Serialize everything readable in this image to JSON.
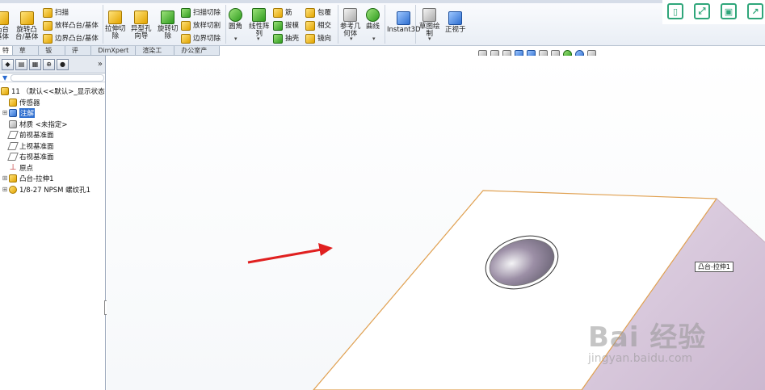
{
  "ribbon": {
    "col1": [
      "凸台",
      "基体"
    ],
    "col2": [
      "旋转凸",
      "台/基体"
    ],
    "sweep": "扫描",
    "loft_boss": "放样凸台/基体",
    "boundary_boss": "边界凸台/基体",
    "extrude_cut": [
      "拉伸切",
      "除"
    ],
    "hole_wizard": [
      "异型孔",
      "向导"
    ],
    "revolve_cut": [
      "旋转切",
      "除"
    ],
    "sweep_cut": "扫描切除",
    "loft_cut": "放样切割",
    "boundary_cut": "边界切除",
    "fillet": "圆角",
    "linear_pattern": [
      "线性阵",
      "列"
    ],
    "rib": "筋",
    "draft": "拔模",
    "shell": "抽壳",
    "wrap": "包覆",
    "intersect": "相交",
    "mirror": "镜向",
    "ref_geometry": [
      "参考几",
      "何体"
    ],
    "curves": "曲线",
    "instant3d": "Instant3D",
    "sketch": [
      "草图绘",
      "制"
    ],
    "normal_to": "正视于"
  },
  "tabs": [
    "特征",
    "草图",
    "钣金",
    "评估",
    "DimXpert",
    "渲染工具",
    "办公室产品"
  ],
  "tree": {
    "root": "11 （默认<<默认>_显示状态 1>）",
    "items": [
      {
        "label": "传感器",
        "icon": "sensor-icon"
      },
      {
        "label": "注解",
        "icon": "annotation-icon",
        "selected": true
      },
      {
        "label": "材质 <未指定>",
        "icon": "material-icon"
      },
      {
        "label": "前视基准面",
        "icon": "plane-icon"
      },
      {
        "label": "上视基准面",
        "icon": "plane-icon"
      },
      {
        "label": "右视基准面",
        "icon": "plane-icon"
      },
      {
        "label": "原点",
        "icon": "origin-icon"
      },
      {
        "label": "凸台-拉伸1",
        "icon": "extrude-icon"
      },
      {
        "label": "1/8-27 NPSM 螺纹孔1",
        "icon": "hole-icon"
      }
    ]
  },
  "model": {
    "tag": "凸台-拉伸1",
    "top_face_color": "#ffffff",
    "side_face_color": "#d8c9dc",
    "edge_color": "#e0a050",
    "arrow_color": "#e02020"
  },
  "watermark": {
    "logo": "Bai 经验",
    "url": "jingyan.baidu.com"
  }
}
